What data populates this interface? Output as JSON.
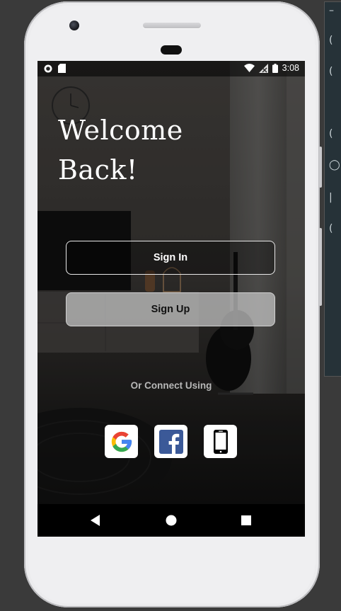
{
  "status_bar": {
    "time": "3:08",
    "left_icons": [
      "record-icon",
      "sd-card-icon"
    ],
    "right_icons": [
      "wifi-icon",
      "no-signal-icon",
      "battery-icon"
    ]
  },
  "welcome": {
    "line1": "Welcome",
    "line2": "Back!"
  },
  "buttons": {
    "sign_in": "Sign In",
    "sign_up": "Sign Up"
  },
  "connect": {
    "label": "Or Connect Using",
    "options": [
      "google-icon",
      "facebook-icon",
      "phone-icon"
    ]
  },
  "nav": {
    "icons": [
      "back-icon",
      "home-icon",
      "recents-icon"
    ]
  },
  "colors": {
    "facebook": "#3b5998",
    "google_blue": "#4285F4",
    "google_red": "#EA4335",
    "google_yellow": "#FBBC05",
    "google_green": "#34A853"
  }
}
